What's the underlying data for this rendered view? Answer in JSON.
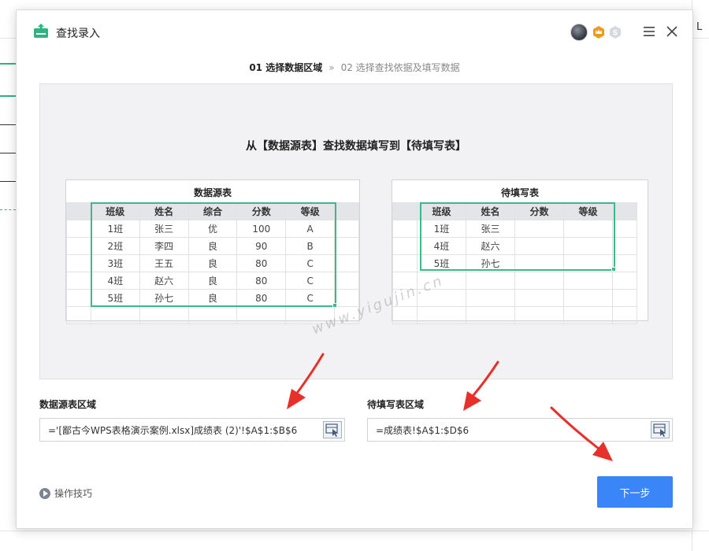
{
  "app": {
    "title": "查找录入"
  },
  "background": {
    "column_letter": "L"
  },
  "steps": {
    "step1": "01 选择数据区域",
    "separator": "»",
    "step2": "02 选择查找依据及填写数据"
  },
  "preview": {
    "heading": "从【数据源表】查找数据填写到【待填写表】",
    "source_table": {
      "title": "数据源表",
      "headers": [
        "班级",
        "姓名",
        "综合",
        "分数",
        "等级"
      ],
      "rows": [
        [
          "1班",
          "张三",
          "优",
          "100",
          "A"
        ],
        [
          "2班",
          "李四",
          "良",
          "90",
          "B"
        ],
        [
          "3班",
          "王五",
          "良",
          "80",
          "C"
        ],
        [
          "4班",
          "赵六",
          "良",
          "80",
          "C"
        ],
        [
          "5班",
          "孙七",
          "良",
          "80",
          "C"
        ]
      ]
    },
    "target_table": {
      "title": "待填写表",
      "headers": [
        "班级",
        "姓名",
        "分数",
        "等级"
      ],
      "rows": [
        [
          "1班",
          "张三",
          "",
          ""
        ],
        [
          "4班",
          "赵六",
          "",
          ""
        ],
        [
          "5班",
          "孙七",
          "",
          ""
        ]
      ]
    },
    "watermark": "www.yigujin.cn"
  },
  "source_field": {
    "label": "数据源表区域",
    "value": "='[鄙古今WPS表格演示案例.xlsx]成绩表 (2)'!$A$1:$B$6"
  },
  "target_field": {
    "label": "待填写表区域",
    "value": "=成绩表!$A$1:$D$6"
  },
  "tips": {
    "label": "操作技巧"
  },
  "next_button": {
    "label": "下一步"
  },
  "colors": {
    "accent_green": "#3cb88a",
    "primary_blue": "#3a86f8",
    "annotation_red": "#e8302a"
  }
}
